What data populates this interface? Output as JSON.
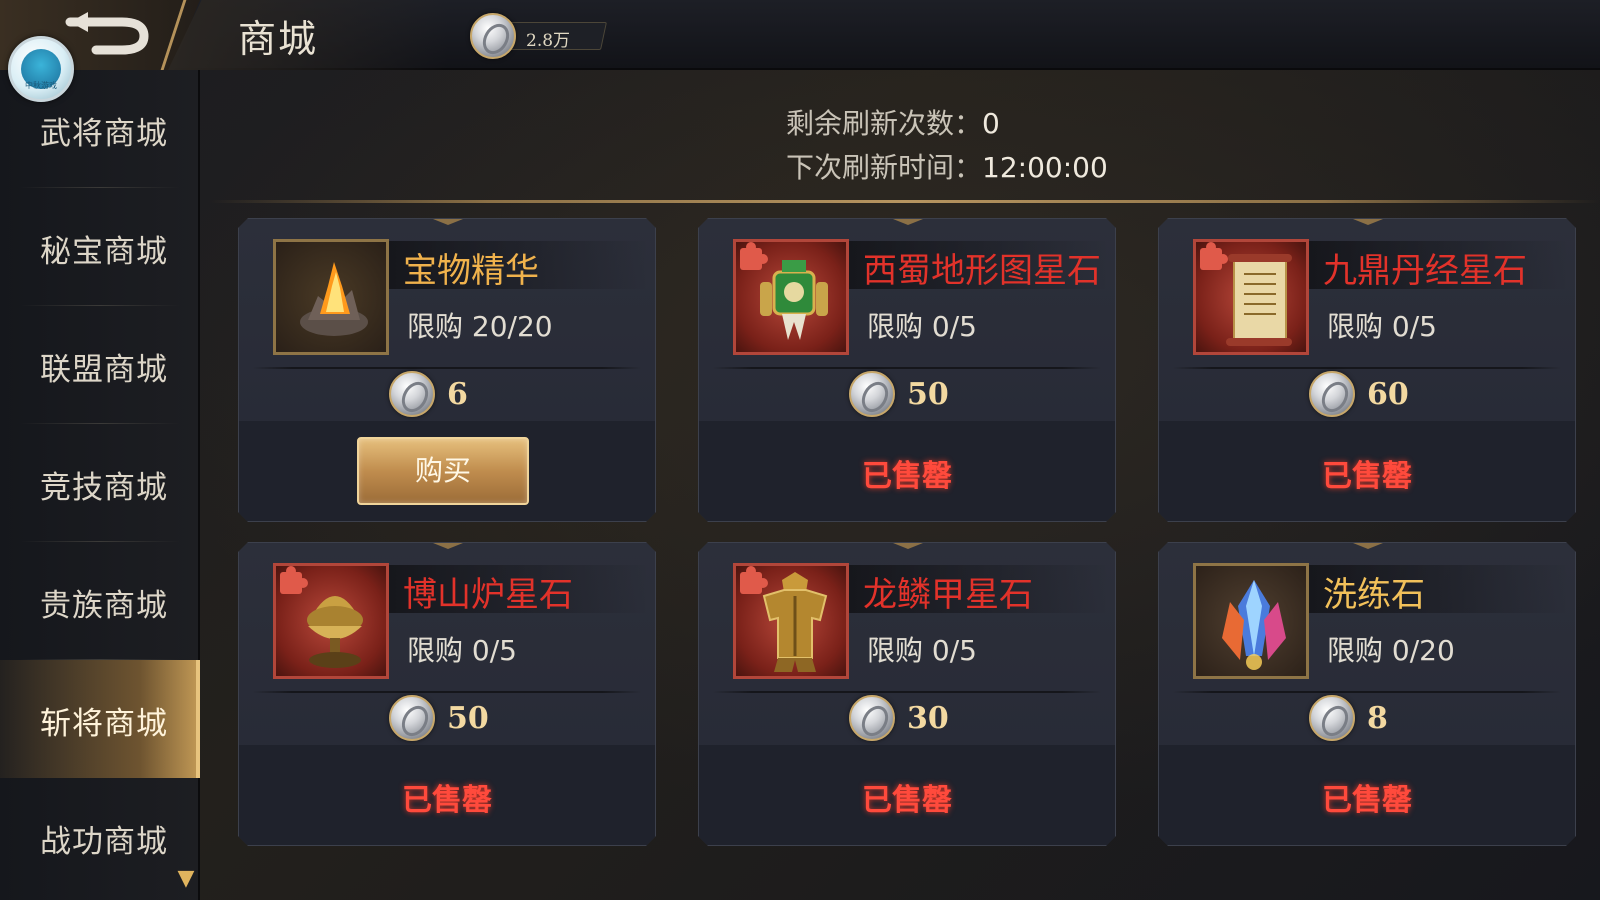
{
  "header": {
    "title": "商城",
    "currency_amount": "2.8万",
    "logo_text": "中秋游戏"
  },
  "sidebar": {
    "items": [
      {
        "label": "武将商城",
        "active": false
      },
      {
        "label": "秘宝商城",
        "active": false
      },
      {
        "label": "联盟商城",
        "active": false
      },
      {
        "label": "竞技商城",
        "active": false
      },
      {
        "label": "贵族商城",
        "active": false
      },
      {
        "label": "斩将商城",
        "active": true
      },
      {
        "label": "战功商城",
        "active": false
      }
    ]
  },
  "refresh": {
    "remaining_label": "剩余刷新次数：",
    "remaining_value": "0",
    "next_label": "下次刷新时间：",
    "next_value": "12:00:00"
  },
  "shop": {
    "items": [
      {
        "name": "宝物精华",
        "name_color": "gold",
        "limit": "限购  20/20",
        "price": "6",
        "state": "buy",
        "button_label": "购买",
        "icon": "fire-crystal-icon"
      },
      {
        "name": "西蜀地形图星石",
        "name_color": "red",
        "limit": "限购  0/5",
        "price": "50",
        "state": "sold",
        "sold_label": "已售罄",
        "icon": "jade-artifact-icon"
      },
      {
        "name": "九鼎丹经星石",
        "name_color": "red",
        "limit": "限购  0/5",
        "price": "60",
        "state": "sold",
        "sold_label": "已售罄",
        "icon": "scroll-icon"
      },
      {
        "name": "博山炉星石",
        "name_color": "red",
        "limit": "限购  0/5",
        "price": "50",
        "state": "sold",
        "sold_label": "已售罄",
        "icon": "incense-burner-icon"
      },
      {
        "name": "龙鳞甲星石",
        "name_color": "red",
        "limit": "限购  0/5",
        "price": "30",
        "state": "sold",
        "sold_label": "已售罄",
        "icon": "armor-icon"
      },
      {
        "name": "洗练石",
        "name_color": "yellow",
        "limit": "限购  0/20",
        "price": "8",
        "state": "sold",
        "sold_label": "已售罄",
        "icon": "gem-icon"
      }
    ]
  },
  "colors": {
    "accent_gold": "#c39a56",
    "sold_red": "#ff4a3c",
    "card_bg": "#2c2f3a"
  }
}
